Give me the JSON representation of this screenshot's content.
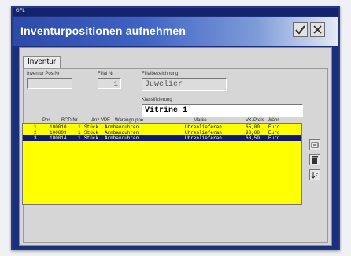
{
  "window": {
    "caption": "GFL",
    "app_title": "Inventurpositionen aufnehmen"
  },
  "tabs": [
    {
      "label": "Inventur"
    }
  ],
  "form": {
    "pos_nr_label": "Inventur Pos Nr",
    "pos_nr_value": "",
    "filial_label": "Filial Nr",
    "filial_value": "1",
    "filial_name_label": "Filialbezeichnung",
    "filial_name_value": "Juwelier",
    "klass_label": "Klassifizierung",
    "klass_value": "Vitrine 1"
  },
  "grid": {
    "headers": [
      "Pos",
      "BCD Nr",
      "Anz VPE",
      "Warengruppe",
      "Marke",
      "VK-Preis",
      "Währ"
    ],
    "rows": [
      {
        "pos": "1",
        "bcd": "100010",
        "anz": "1",
        "vpe": "Stück",
        "gruppe": "Armbanduhren",
        "marke": "Uhrenlieferan",
        "preis": "65,00",
        "waehr": "Euro",
        "selected": false
      },
      {
        "pos": "2",
        "bcd": "100009",
        "anz": "1",
        "vpe": "Stück",
        "gruppe": "Armbanduhren",
        "marke": "Uhrenlieferan",
        "preis": "90,00",
        "waehr": "Euro",
        "selected": false
      },
      {
        "pos": "3",
        "bcd": "100014",
        "anz": "1",
        "vpe": "Stück",
        "gruppe": "Armbanduhren",
        "marke": "Uhrenlieferan",
        "preis": "60,50",
        "waehr": "Euro",
        "selected": true
      }
    ]
  },
  "side_buttons": [
    {
      "icon": "edit-icon"
    },
    {
      "icon": "trash-icon"
    },
    {
      "icon": "sort-icon"
    }
  ],
  "colors": {
    "grid_bg": "#ffff00",
    "selected_row": "#0d1a70",
    "title_bg": "#1b2f7a"
  }
}
